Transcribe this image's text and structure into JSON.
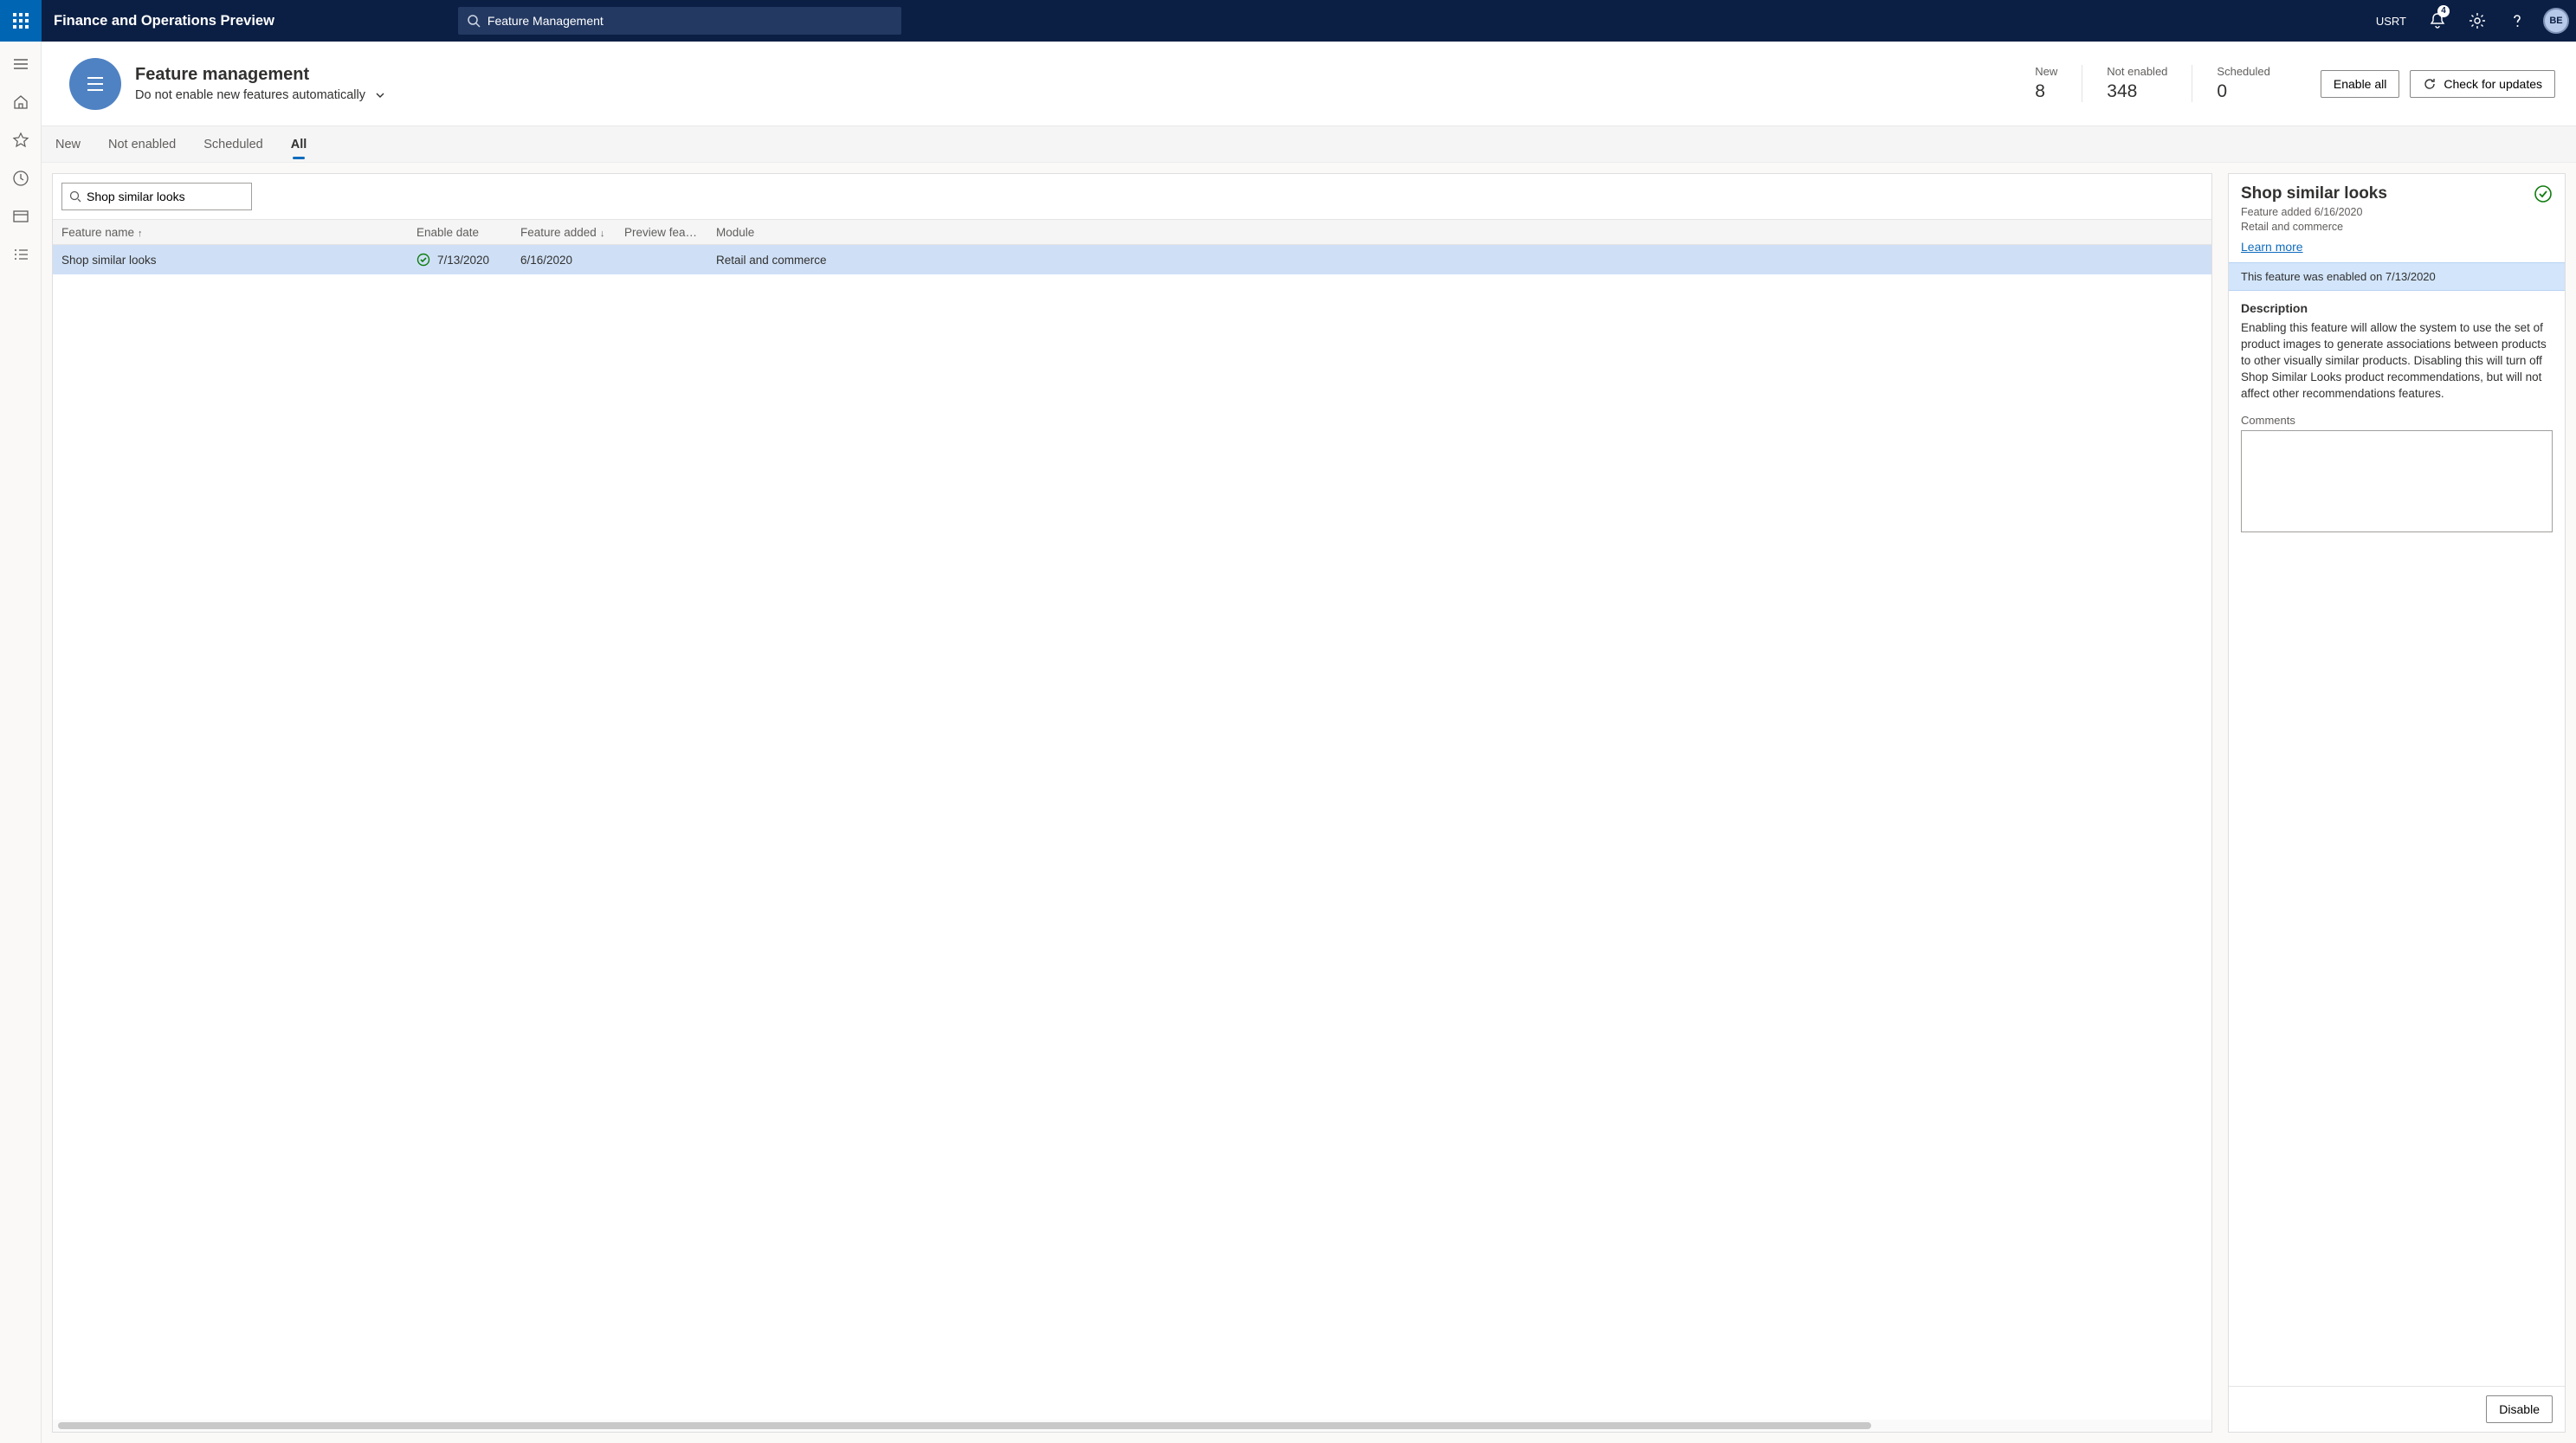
{
  "appBar": {
    "title": "Finance and Operations Preview",
    "searchValue": "Feature Management",
    "userLabel": "USRT",
    "notificationCount": "4",
    "avatarInitials": "BE"
  },
  "header": {
    "title": "Feature management",
    "subtitle": "Do not enable new features automatically",
    "kpis": {
      "new": {
        "label": "New",
        "value": "8"
      },
      "notEnabled": {
        "label": "Not enabled",
        "value": "348"
      },
      "scheduled": {
        "label": "Scheduled",
        "value": "0"
      }
    },
    "enableAll": "Enable all",
    "checkUpdates": "Check for updates"
  },
  "tabs": {
    "new": "New",
    "notEnabled": "Not enabled",
    "scheduled": "Scheduled",
    "all": "All"
  },
  "grid": {
    "searchValue": "Shop similar looks",
    "columns": {
      "featureName": "Feature name",
      "enableDate": "Enable date",
      "featureAdded": "Feature added",
      "previewFeature": "Preview feature",
      "module": "Module"
    },
    "rows": [
      {
        "name": "Shop similar looks",
        "enableDate": "7/13/2020",
        "featureAdded": "6/16/2020",
        "preview": "",
        "module": "Retail and commerce"
      }
    ]
  },
  "details": {
    "title": "Shop similar looks",
    "addedLine": "Feature added 6/16/2020",
    "moduleLine": "Retail and commerce",
    "learnMore": "Learn more",
    "enabledBanner": "This feature was enabled on 7/13/2020",
    "descriptionLabel": "Description",
    "descriptionText": "Enabling this feature will allow the system to use the set of product images to generate associations between products to other visually similar products. Disabling this will turn off Shop Similar Looks product recommendations, but will not affect other recommendations features.",
    "commentsLabel": "Comments",
    "commentsValue": "",
    "disableLabel": "Disable"
  }
}
